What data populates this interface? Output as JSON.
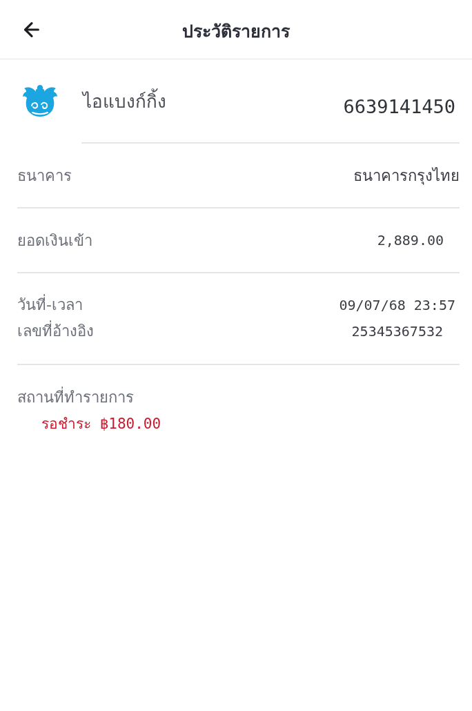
{
  "header": {
    "title": "ประวัติรายการ"
  },
  "account": {
    "name": "ไอแบงก์กิ้ง",
    "number": "6639141450"
  },
  "sections": [
    {
      "rows": [
        {
          "label": "ธนาคาร",
          "value": "ธนาคารกรุงไทย",
          "kind": "text"
        }
      ]
    },
    {
      "rows": [
        {
          "label": "ยอดเงินเข้า",
          "value": "2,889.00",
          "kind": "mono"
        }
      ]
    },
    {
      "rows": [
        {
          "label": "วันที่-เวลา",
          "value": "09/07/68 23:57",
          "kind": "mono"
        },
        {
          "label": "เลขที่อ้างอิง",
          "value": "25345367532",
          "kind": "mono"
        }
      ]
    }
  ],
  "location": {
    "label": "สถานที่ทำรายการ",
    "value": "รอชำระ ฿180.00"
  }
}
